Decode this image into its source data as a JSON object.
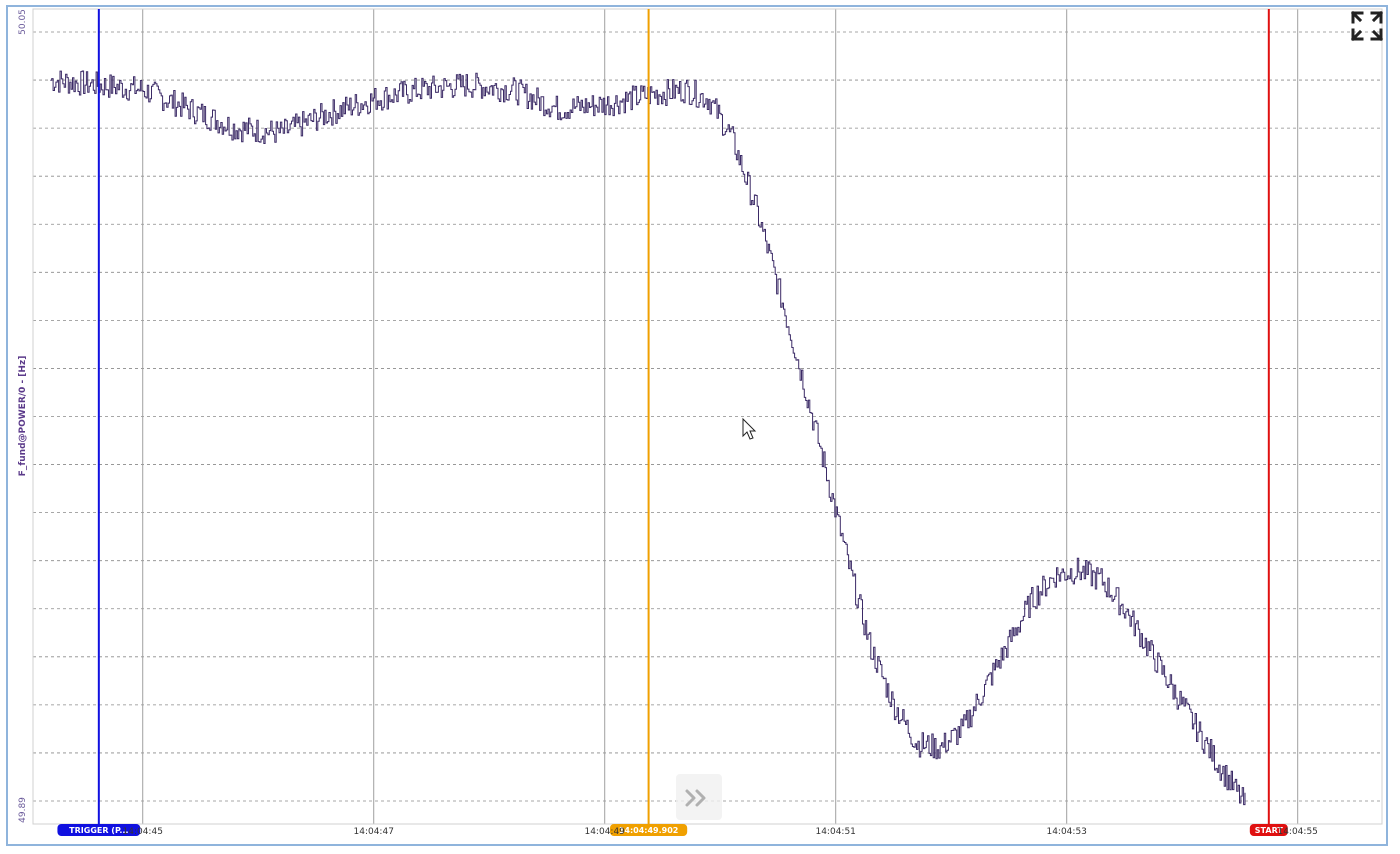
{
  "chart_data": {
    "type": "line",
    "ylabel": "F_fund@POWER/0 - [Hz]",
    "ylim": [
      49.89,
      50.05
    ],
    "y_tick_labels": [
      "50.05",
      "49.89"
    ],
    "grid": true,
    "x_tick_labels": [
      "14:04:45",
      "14:04:47",
      "14:04:49",
      "14:04:51",
      "14:04:53",
      "14:04:55"
    ],
    "x_tick_seconds": [
      45,
      47,
      49,
      51,
      53,
      55
    ],
    "xlim_seconds": [
      44.05,
      55.73
    ],
    "series": [
      {
        "color": "#3b2a66",
        "x": [
          44.2,
          44.6,
          45.0,
          45.4,
          45.8,
          46.2,
          46.6,
          47.0,
          47.4,
          47.8,
          48.2,
          48.6,
          49.0,
          49.4,
          49.7,
          49.9,
          50.1,
          50.3,
          50.5,
          50.7,
          50.9,
          51.1,
          51.3,
          51.5,
          51.7,
          51.9,
          52.1,
          52.3,
          52.5,
          52.7,
          52.9,
          53.1,
          53.3,
          53.5,
          53.7,
          53.9,
          54.1,
          54.3,
          54.55
        ],
        "values": [
          50.04,
          50.039,
          50.038,
          50.034,
          50.03,
          50.029,
          50.033,
          50.036,
          50.038,
          50.039,
          50.038,
          50.034,
          50.035,
          50.037,
          50.038,
          50.036,
          50.028,
          50.014,
          49.997,
          49.979,
          49.96,
          49.94,
          49.922,
          49.91,
          49.902,
          49.901,
          49.905,
          49.914,
          49.923,
          49.932,
          49.937,
          49.938,
          49.936,
          49.93,
          49.922,
          49.914,
          49.906,
          49.898,
          49.889
        ]
      }
    ],
    "markers": [
      {
        "label": "TRIGGER (P...",
        "x": 44.62,
        "color": "#1010e0"
      },
      {
        "label": "14:04:49.902",
        "x": 49.38,
        "color": "#f0a000"
      },
      {
        "label": "START",
        "x": 54.75,
        "color": "#e01010"
      }
    ]
  },
  "icons": {
    "expand": "expand-icon",
    "skip": "fast-forward-icon",
    "cursor": "mouse-pointer-icon"
  }
}
